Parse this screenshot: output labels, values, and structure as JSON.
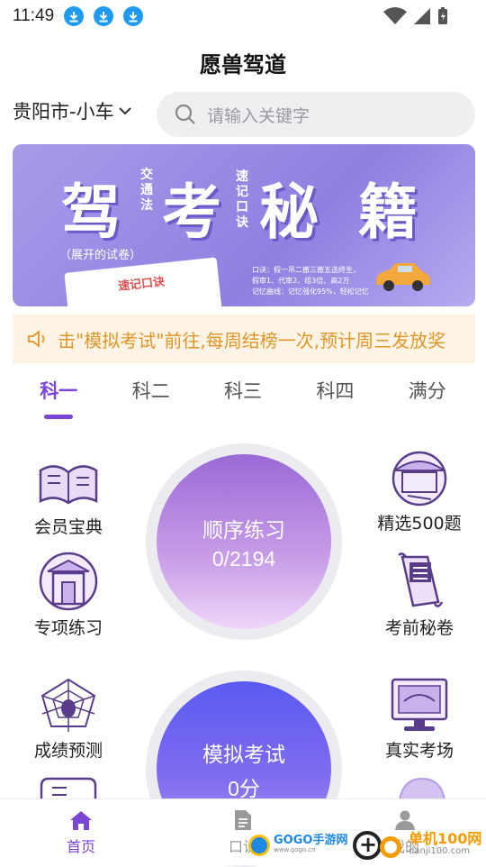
{
  "status_bar": {
    "time": "11:49"
  },
  "app": {
    "title": "愿兽驾道"
  },
  "location": {
    "city": "贵阳市-小车"
  },
  "search": {
    "placeholder": "请输入关键字"
  },
  "banner": {
    "title_chars": [
      "驾",
      "考",
      "秘",
      "籍"
    ],
    "tag_left": "交通法",
    "tag_right": "速记口诀",
    "subtitle": "（展开的试卷）",
    "card_label": "速记口诀",
    "tip_line1": "口诀：假一吊二撤三撤五选终生，",
    "tip_line2": "假审1、代审2、组3倍、高2万",
    "tip_line3": "记忆曲线：记忆强化95%，轻松记忆"
  },
  "notice": {
    "text": "击\"模拟考试\"前往,每周结榜一次,预计周三发放奖"
  },
  "tabs": [
    "科一",
    "科二",
    "科三",
    "科四",
    "满分"
  ],
  "active_tab": 0,
  "features": {
    "left": [
      {
        "label": "会员宝典",
        "icon": "book-icon"
      },
      {
        "label": "专项练习",
        "icon": "gate-icon"
      },
      {
        "label": "成绩预测",
        "icon": "spider-icon"
      }
    ],
    "right": [
      {
        "label": "精选500题",
        "icon": "pavilion-icon"
      },
      {
        "label": "考前秘卷",
        "icon": "scroll-icon"
      },
      {
        "label": "真实考场",
        "icon": "monitor-icon"
      }
    ]
  },
  "practice": {
    "title": "顺序练习",
    "value": "0/2194"
  },
  "exam": {
    "title": "模拟考试",
    "value": "0分"
  },
  "bottom_nav": [
    {
      "label": "首页",
      "icon": "home-icon"
    },
    {
      "label": "口诀",
      "icon": "document-icon"
    },
    {
      "label": "我的",
      "icon": "user-icon"
    }
  ],
  "watermarks": {
    "left": "GOGO手游网",
    "left_sub": "www.gogo.cn",
    "right": "单机100网",
    "right_sub": "danji100.com"
  },
  "colors": {
    "accent": "#7a46d6",
    "notice": "#e09628"
  }
}
